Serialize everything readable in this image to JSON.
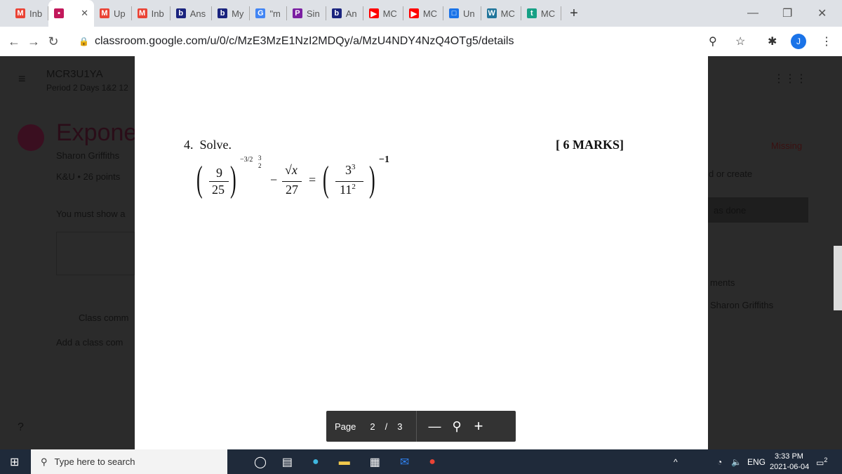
{
  "tabs": [
    {
      "label": "Inb",
      "icon": "gmail-icon"
    },
    {
      "label": "",
      "icon": "classroom-icon",
      "active": true
    },
    {
      "label": "Up",
      "icon": "gmail-icon"
    },
    {
      "label": "Inb",
      "icon": "gmail-icon"
    },
    {
      "label": "Ans",
      "icon": "bartleby-icon"
    },
    {
      "label": "My",
      "icon": "bartleby-icon"
    },
    {
      "label": "\"m",
      "icon": "google-icon"
    },
    {
      "label": "Sin",
      "icon": "pm-icon"
    },
    {
      "label": "An",
      "icon": "bartleby-icon"
    },
    {
      "label": "MC",
      "icon": "youtube-icon"
    },
    {
      "label": "MC",
      "icon": "youtube-icon"
    },
    {
      "label": "Un",
      "icon": "docs-icon"
    },
    {
      "label": "MC",
      "icon": "wordpress-icon"
    },
    {
      "label": "MC",
      "icon": "t-icon"
    }
  ],
  "url": "classroom.google.com/u/0/c/MzE3MzE1NzI2MDQy/a/MzU4NDY4NzQ4OTg5/details",
  "avatar": "J",
  "class": {
    "name": "MCR3U1YA",
    "period": "Period 2 Days 1&2 12"
  },
  "assignment": {
    "title": "Expone",
    "author": "Sharon Griffiths",
    "points": "K&U • 26 points",
    "instructions": "You must show a",
    "missing": "Missing",
    "add": "d or create",
    "mark_done": "as done",
    "comments": "ments",
    "commenter": "Sharon Griffiths",
    "class_comments": "Class comm",
    "add_class_comment": "Add a class com"
  },
  "doc": {
    "question": "4.  Solve.",
    "marks": "[ 6 MARKS]",
    "f1_num": "9",
    "f1_den": "25",
    "exp1": "−3/2",
    "exp1_n": "3",
    "exp1_d": "2",
    "minus": "−",
    "sqrt": "√x",
    "f2_den": "27",
    "eq": "=",
    "f3_num": "3",
    "f3_num_exp": "3",
    "f3_den": "11",
    "f3_den_exp": "2",
    "exp3": "−1"
  },
  "pagebar": {
    "label": "Page",
    "current": "2",
    "sep": "/",
    "total": "3"
  },
  "taskbar": {
    "search_placeholder": "Type here to search",
    "lang": "ENG",
    "time": "3:33 PM",
    "date": "2021-06-04",
    "notif": "2"
  }
}
